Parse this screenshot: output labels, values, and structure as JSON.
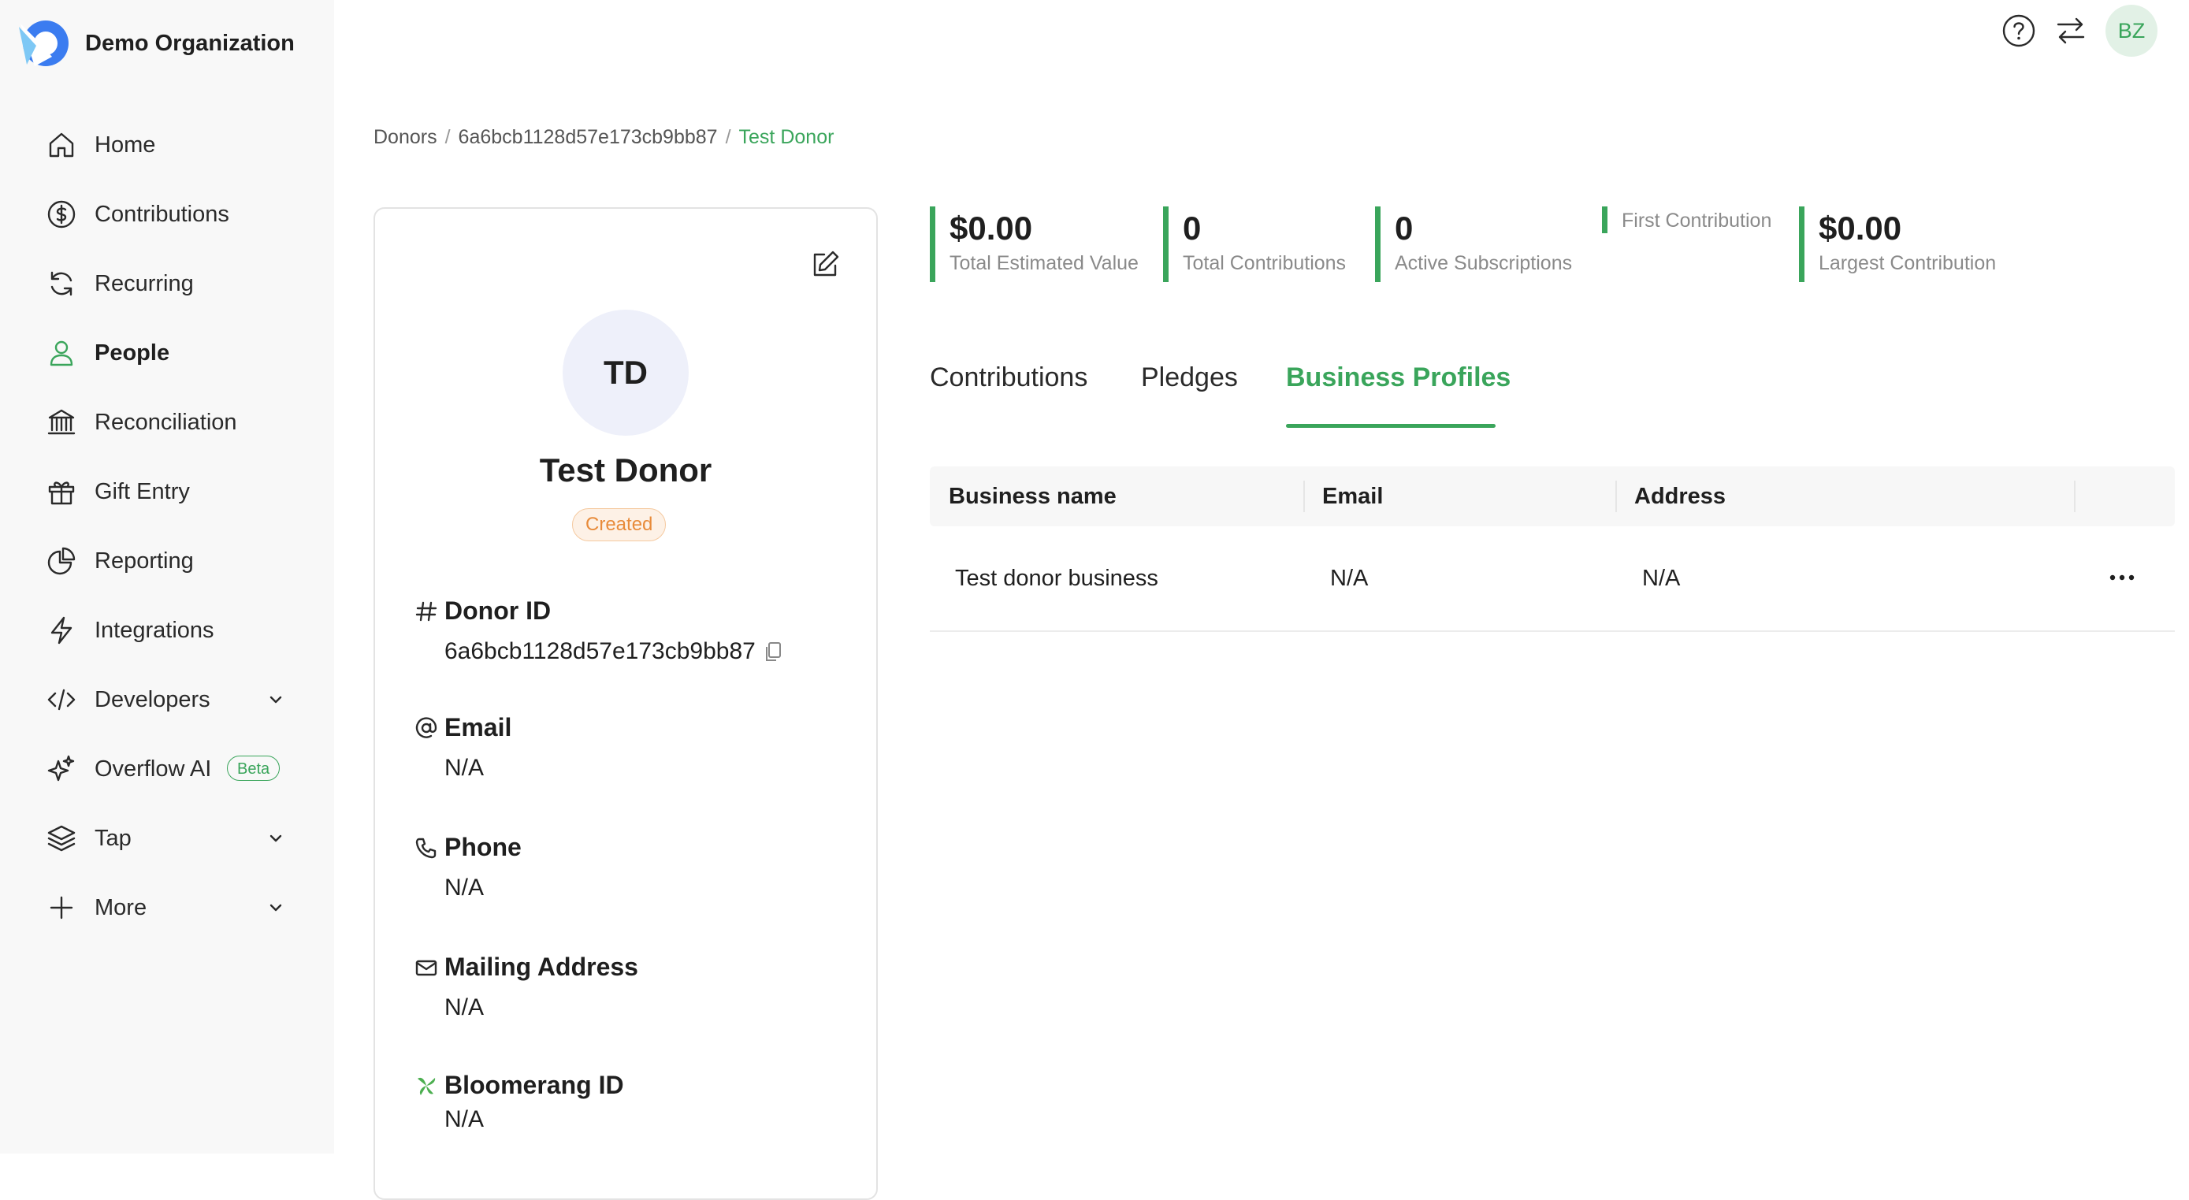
{
  "org": {
    "name": "Demo Organization"
  },
  "nav": [
    {
      "label": "Home",
      "icon": "home-icon"
    },
    {
      "label": "Contributions",
      "icon": "dollar-circle-icon"
    },
    {
      "label": "Recurring",
      "icon": "refresh-icon"
    },
    {
      "label": "People",
      "icon": "user-icon",
      "active": true
    },
    {
      "label": "Reconciliation",
      "icon": "bank-icon"
    },
    {
      "label": "Gift Entry",
      "icon": "gift-icon"
    },
    {
      "label": "Reporting",
      "icon": "pie-chart-icon"
    },
    {
      "label": "Integrations",
      "icon": "lightning-icon"
    },
    {
      "label": "Developers",
      "icon": "code-icon",
      "expandable": true
    },
    {
      "label": "Overflow AI",
      "icon": "sparkles-icon",
      "badge": "Beta"
    },
    {
      "label": "Tap",
      "icon": "layers-icon",
      "expandable": true
    },
    {
      "label": "More",
      "icon": "plus-icon",
      "expandable": true
    }
  ],
  "topbar": {
    "user_initials": "BZ"
  },
  "breadcrumb": [
    "Donors",
    "6a6bcb1128d57e173cb9bb87",
    "Test Donor"
  ],
  "profile": {
    "initials": "TD",
    "name": "Test Donor",
    "status": "Created",
    "fields": {
      "donor_id": {
        "label": "Donor ID",
        "value": "6a6bcb1128d57e173cb9bb87"
      },
      "email": {
        "label": "Email",
        "value": "N/A"
      },
      "phone": {
        "label": "Phone",
        "value": "N/A"
      },
      "mailing": {
        "label": "Mailing Address",
        "value": "N/A"
      },
      "bloomerang": {
        "label": "Bloomerang ID",
        "value": "N/A"
      }
    }
  },
  "stats": [
    {
      "value": "$0.00",
      "label": "Total Estimated Value"
    },
    {
      "value": "0",
      "label": "Total Contributions"
    },
    {
      "value": "0",
      "label": "Active Subscriptions"
    },
    {
      "value": "",
      "label": "First Contribution"
    },
    {
      "value": "$0.00",
      "label": "Largest Contribution"
    }
  ],
  "tabs": [
    {
      "label": "Contributions"
    },
    {
      "label": "Pledges"
    },
    {
      "label": "Business Profiles",
      "active": true
    }
  ],
  "table": {
    "columns": [
      "Business name",
      "Email",
      "Address"
    ],
    "rows": [
      [
        "Test donor business",
        "N/A",
        "N/A"
      ]
    ]
  },
  "colors": {
    "accent": "#3aa55b",
    "status_created": "#e88b3a"
  }
}
